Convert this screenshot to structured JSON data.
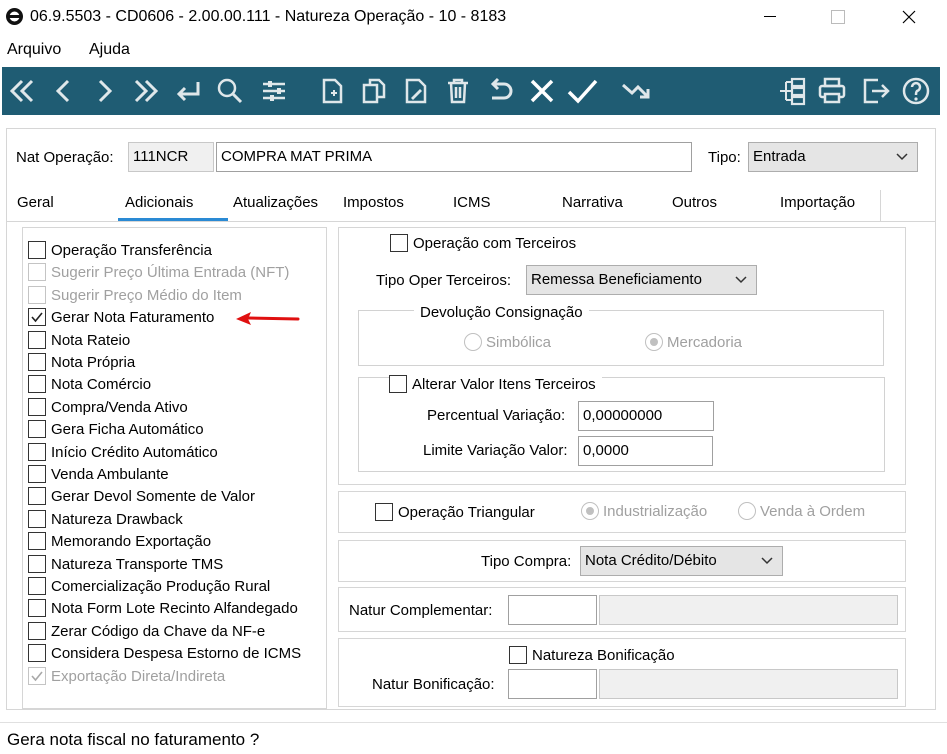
{
  "window": {
    "title": "06.9.5503 - CD0606 - 2.00.00.111 - Natureza Operação - 10 - 8183"
  },
  "menu": {
    "items": [
      "Arquivo",
      "Ajuda"
    ]
  },
  "toolbar": {
    "color": "#1f5c73",
    "icons": [
      "first-icon",
      "previous-icon",
      "next-icon",
      "last-icon",
      "goto-icon",
      "search-icon",
      "filter-icon",
      "new-icon",
      "copy-icon",
      "edit-icon",
      "delete-icon",
      "undo-icon",
      "cancel-icon",
      "confirm-icon",
      "zoom-icon",
      "structure-icon",
      "print-icon",
      "exit-icon",
      "help-icon"
    ]
  },
  "header": {
    "nat_operacao_label": "Nat Operação:",
    "nat_operacao_code": "111NCR",
    "nat_operacao_desc": "COMPRA MAT PRIMA",
    "tipo_label": "Tipo:",
    "tipo_value": "Entrada"
  },
  "tabs": [
    "Geral",
    "Adicionais",
    "Atualizações",
    "Impostos",
    "ICMS",
    "Narrativa",
    "Outros",
    "Importação"
  ],
  "active_tab": "Adicionais",
  "left_checks": [
    {
      "label": "Operação Transferência",
      "checked": false,
      "disabled": false
    },
    {
      "label": "Sugerir Preço Última Entrada (NFT)",
      "checked": false,
      "disabled": true
    },
    {
      "label": "Sugerir Preço Médio do Item",
      "checked": false,
      "disabled": true
    },
    {
      "label": "Gerar Nota Faturamento",
      "checked": true,
      "disabled": false
    },
    {
      "label": "Nota Rateio",
      "checked": false,
      "disabled": false
    },
    {
      "label": "Nota Própria",
      "checked": false,
      "disabled": false
    },
    {
      "label": "Nota Comércio",
      "checked": false,
      "disabled": false
    },
    {
      "label": "Compra/Venda Ativo",
      "checked": false,
      "disabled": false
    },
    {
      "label": "Gera Ficha Automático",
      "checked": false,
      "disabled": false
    },
    {
      "label": "Início Crédito Automático",
      "checked": false,
      "disabled": false
    },
    {
      "label": "Venda Ambulante",
      "checked": false,
      "disabled": false
    },
    {
      "label": "Gerar Devol Somente de Valor",
      "checked": false,
      "disabled": false
    },
    {
      "label": "Natureza Drawback",
      "checked": false,
      "disabled": false
    },
    {
      "label": "Memorando Exportação",
      "checked": false,
      "disabled": false
    },
    {
      "label": "Natureza Transporte TMS",
      "checked": false,
      "disabled": false
    },
    {
      "label": "Comercialização Produção Rural",
      "checked": false,
      "disabled": false
    },
    {
      "label": "Nota Form Lote Recinto Alfandegado",
      "checked": false,
      "disabled": false
    },
    {
      "label": "Zerar Código da Chave da NF-e",
      "checked": false,
      "disabled": false
    },
    {
      "label": "Considera Despesa Estorno de ICMS",
      "checked": false,
      "disabled": false
    },
    {
      "label": "Exportação Direta/Indireta",
      "checked": true,
      "disabled": true
    }
  ],
  "terceiros": {
    "operacao_label": "Operação com Terceiros",
    "tipo_label": "Tipo Oper Terceiros:",
    "tipo_value": "Remessa Beneficiamento",
    "devolucao_label": "Devolução Consignação",
    "radio_simbolica": "Simbólica",
    "radio_mercadoria": "Mercadoria",
    "alterar_label": "Alterar Valor Itens Terceiros",
    "percentual_label": "Percentual Variação:",
    "percentual_value": "0,00000000",
    "limite_label": "Limite Variação Valor:",
    "limite_value": "0,0000"
  },
  "triangular": {
    "label": "Operação Triangular",
    "radio_industrializacao": "Industrialização",
    "radio_venda": "Venda à Ordem"
  },
  "compra": {
    "label": "Tipo Compra:",
    "value": "Nota Crédito/Débito"
  },
  "complementar": {
    "label": "Natur Complementar:",
    "code": "",
    "desc": ""
  },
  "bonificacao": {
    "check_label": "Natureza Bonificação",
    "label": "Natur Bonificação:",
    "code": "",
    "desc": ""
  },
  "annotation": {
    "arrow_color": "#e01010"
  },
  "status": {
    "text": "Gera  nota fiscal no faturamento ?"
  }
}
